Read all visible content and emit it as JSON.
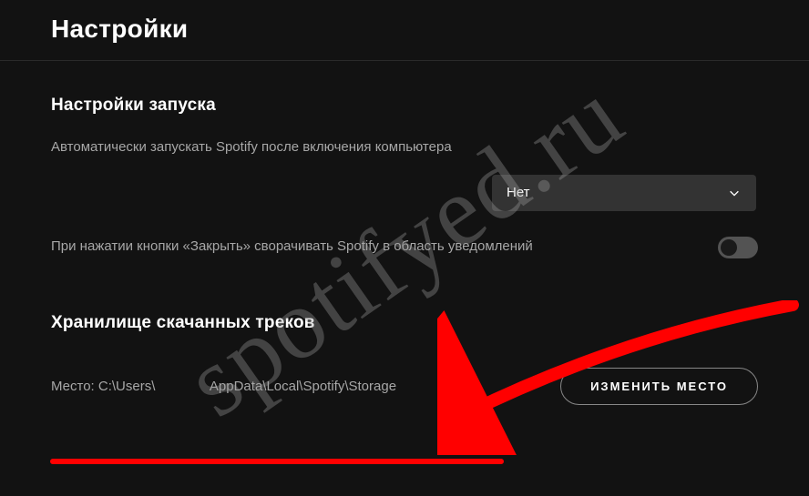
{
  "header": {
    "title": "Настройки"
  },
  "startup": {
    "heading": "Настройки запуска",
    "autostart_label": "Автоматически запускать Spotify после включения компьютера",
    "autostart_value": "Нет",
    "close_to_tray_label": "При нажатии кнопки «Закрыть» сворачивать Spotify в область уведомлений"
  },
  "storage": {
    "heading": "Хранилище скачанных треков",
    "path_prefix": "Место: C:\\Users\\",
    "path_suffix": "AppData\\Local\\Spotify\\Storage",
    "change_button": "ИЗМЕНИТЬ МЕСТО"
  },
  "watermark": {
    "text": "spotifyed.ru"
  },
  "colors": {
    "background": "#121212",
    "text_primary": "#ffffff",
    "text_secondary": "#a7a7a7",
    "control_bg": "#333333",
    "toggle_bg": "#535353",
    "annotation_red": "#ff0000"
  }
}
